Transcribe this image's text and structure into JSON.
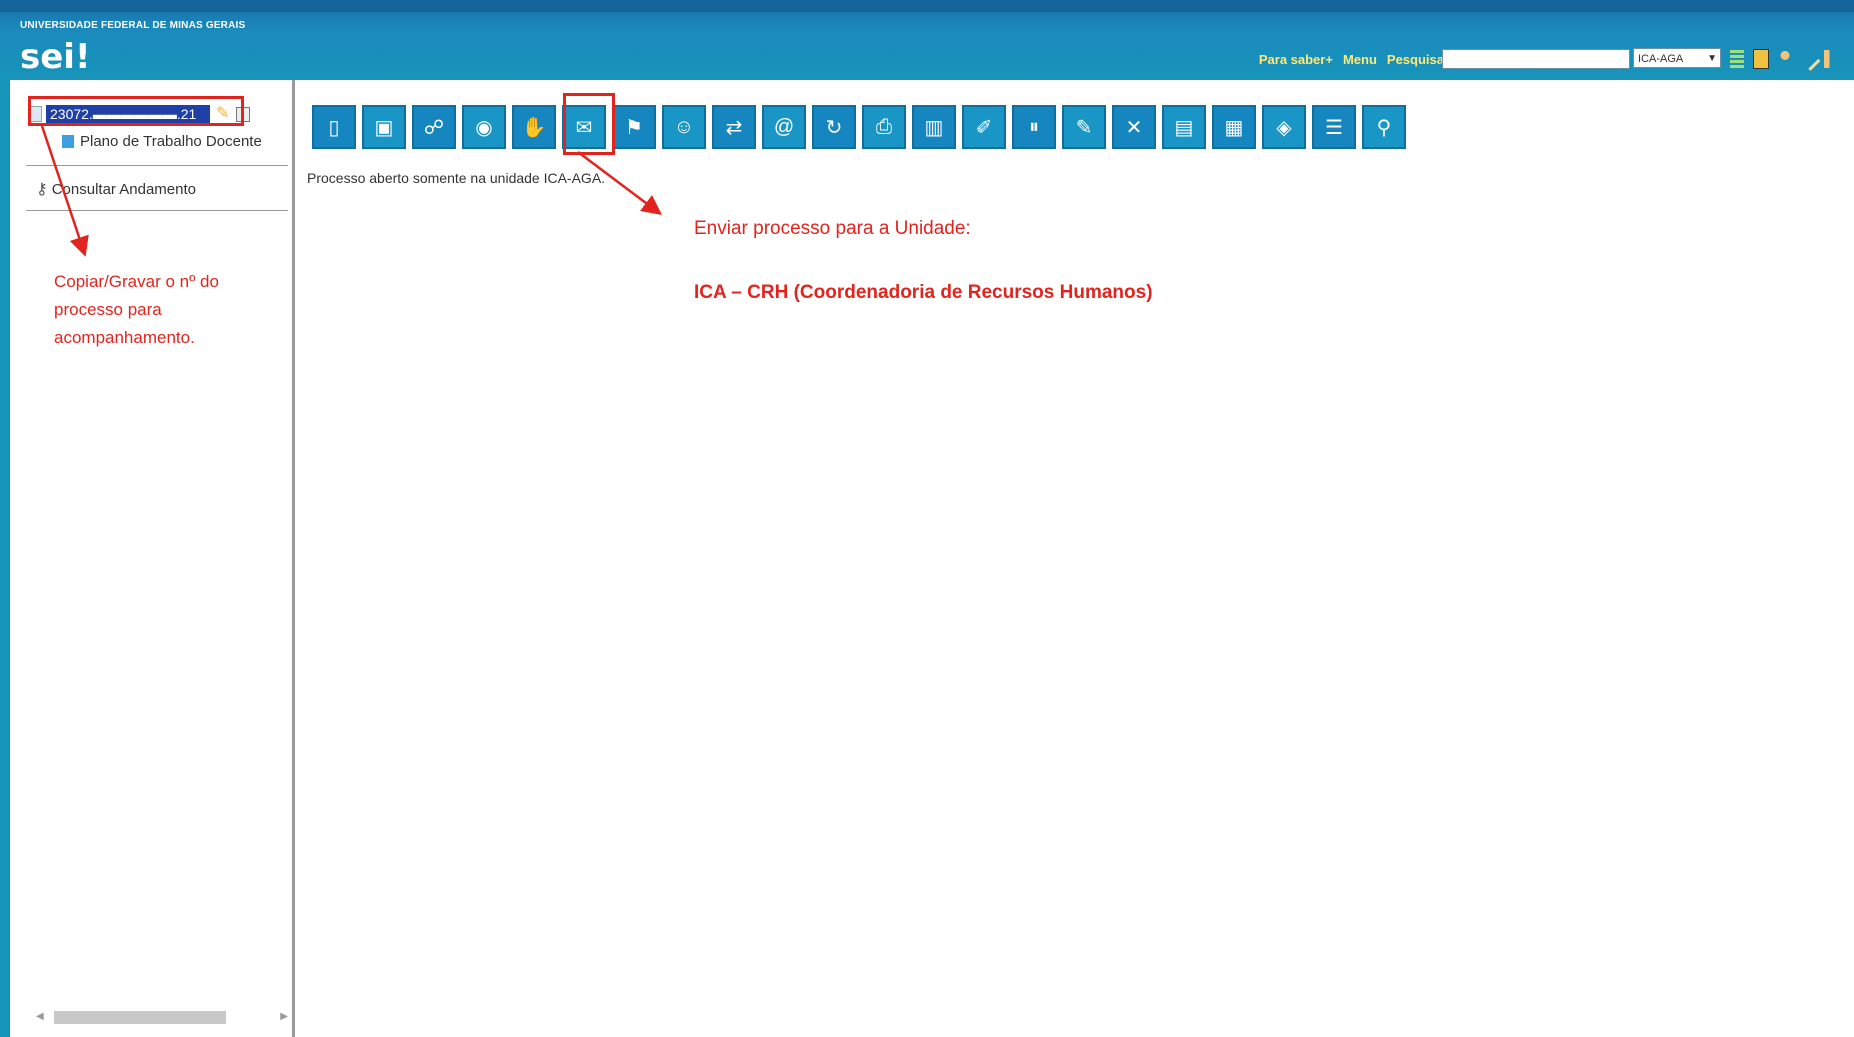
{
  "header": {
    "university": "UNIVERSIDADE FEDERAL DE MINAS GERAIS",
    "logo": "sei!",
    "links": [
      "Para saber+",
      "Menu",
      "Pesquisa"
    ],
    "search_value": "",
    "unit_selected": "ICA-AGA"
  },
  "sidebar": {
    "process_number": "23072.▬▬▬▬▬▬.21",
    "document": "Plano de Trabalho Docente",
    "consult": "Consultar Andamento"
  },
  "toolbar": {
    "buttons": [
      "new-document-icon",
      "clone-icon",
      "assign-icon",
      "track-icon",
      "approve-icon",
      "send-process-icon",
      "relate-icon",
      "person-icon",
      "move-icon",
      "email-icon",
      "refresh-icon",
      "print-icon",
      "building-icon",
      "note-icon",
      "pause-icon",
      "edit-icon",
      "delete-icon",
      "pdf-icon",
      "zip-icon",
      "tag-icon",
      "list-icon",
      "search-icon"
    ]
  },
  "main": {
    "status": "Processo aberto somente na unidade ICA-AGA."
  },
  "annotations": {
    "left": "Copiar/Gravar o nº do processo para acompanhamento.",
    "right_line1": "Enviar processo para a Unidade:",
    "right_line2": "ICA – CRH (Coordenadoria de Recursos Humanos)",
    "color": "#e1241e"
  }
}
